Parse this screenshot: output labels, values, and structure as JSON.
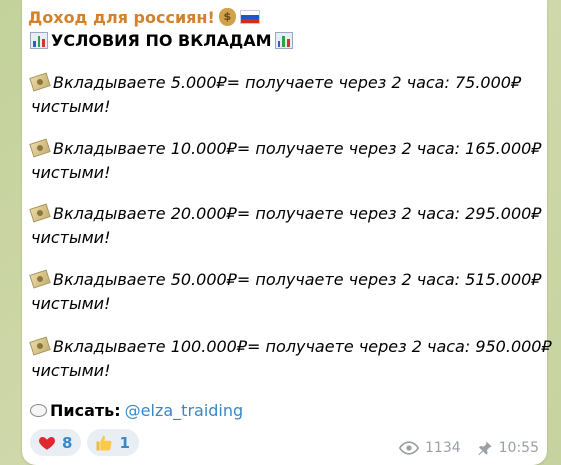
{
  "channel": {
    "title": "Доход для россиян!"
  },
  "headline": "УСЛОВИЯ ПО ВКЛАДАМ",
  "offers": [
    {
      "line1": "Вкладываете 5.000₽= получаете через 2 часа: 75.000₽",
      "line2": "чистыми!"
    },
    {
      "line1": "Вкладываете 10.000₽= получаете через 2 часа: 165.000₽",
      "line2": "чистыми!"
    },
    {
      "line1": "Вкладываете 20.000₽= получаете через 2 часа: 295.000₽",
      "line2": "чистыми!"
    },
    {
      "line1": "Вкладываете 50.000₽=  получаете через 2 часа: 515.000₽",
      "line2": "чистыми!"
    },
    {
      "line1": "Вкладываете 100.000₽= получаете через 2 часа: 950.000₽",
      "line2": "чистыми!"
    }
  ],
  "contact": {
    "label": "Писать:",
    "handle": "@elza_traiding"
  },
  "reactions": [
    {
      "icon": "heart-icon",
      "count": "8"
    },
    {
      "icon": "thumbs-up-icon",
      "count": "1"
    }
  ],
  "meta": {
    "views": "1134",
    "time": "10:55"
  },
  "colors": {
    "channel_title": "#d3812b",
    "link": "#3a87c8",
    "meta": "#9aa0a6"
  },
  "icons": [
    "moneybag-icon",
    "russia-flag-icon",
    "bar-chart-icon",
    "money-icon",
    "speech-bubble-icon",
    "eye-icon",
    "pin-icon"
  ]
}
